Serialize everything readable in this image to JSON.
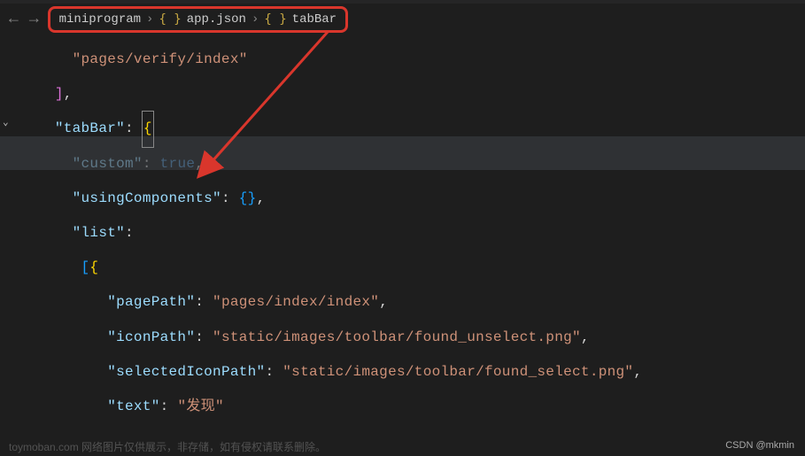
{
  "breadcrumb": {
    "root": "miniprogram",
    "file": "app.json",
    "symbol": "tabBar"
  },
  "code": {
    "l1_str": "\"pages/verify/index\"",
    "l2_close": "],",
    "tabBar_key": "\"tabBar\"",
    "custom_key": "\"custom\"",
    "custom_val": "true",
    "usingComponents_key": "\"usingComponents\"",
    "list_key": "\"list\"",
    "pagePath_key": "\"pagePath\"",
    "pagePath_val": "\"pages/index/index\"",
    "iconPath_key": "\"iconPath\"",
    "iconPath_val": "\"static/images/toolbar/found_unselect.png\"",
    "selectedIconPath_key": "\"selectedIconPath\"",
    "selectedIconPath_val": "\"static/images/toolbar/found_select.png\"",
    "text_key": "\"text\"",
    "text_val": "\"发现\""
  },
  "watermark_left": "toymoban.com 网络图片仅供展示，非存储，如有侵权请联系删除。",
  "watermark_right": "CSDN @mkmin"
}
